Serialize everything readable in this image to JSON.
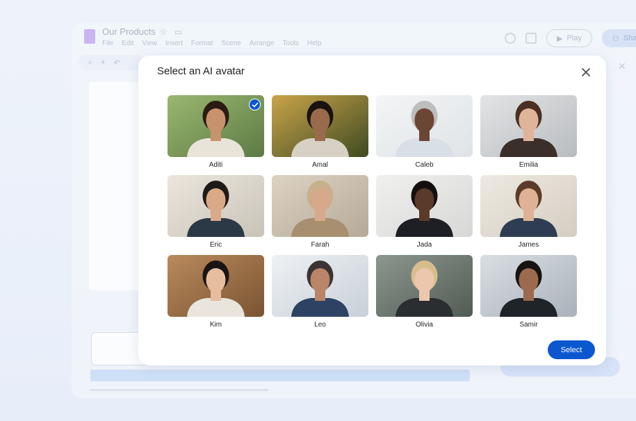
{
  "app": {
    "title": "Our Products",
    "menu": [
      "File",
      "Edit",
      "View",
      "Insert",
      "Format",
      "Scene",
      "Arrange",
      "Tools",
      "Help"
    ],
    "play_label": "Play",
    "share_label": "Share"
  },
  "dialog": {
    "title": "Select an AI avatar",
    "close_icon": "close-icon",
    "select_label": "Select",
    "selected_avatar": "Aditi",
    "avatars": [
      {
        "name": "Aditi",
        "bg": "#5d7a45",
        "bg2": "#9ab870",
        "skin": "#c8926e",
        "hair": "#2b1a12",
        "shirt": "#e9e4d8",
        "selected": true
      },
      {
        "name": "Amal",
        "bg": "#3f4a22",
        "bg2": "#c9a44a",
        "skin": "#9a6a4c",
        "hair": "#1a1210",
        "shirt": "#d7d0c4",
        "selected": false
      },
      {
        "name": "Caleb",
        "bg": "#dfe3e6",
        "bg2": "#f3f5f6",
        "skin": "#6b4634",
        "hair": "#bdbdbd",
        "shirt": "#d8dfe6",
        "selected": false
      },
      {
        "name": "Emilia",
        "bg": "#b9bcbf",
        "bg2": "#e2e4e5",
        "skin": "#e0b49a",
        "hair": "#4a2f22",
        "shirt": "#3a2f2a",
        "selected": false
      },
      {
        "name": "Eric",
        "bg": "#c9c3b8",
        "bg2": "#ebe6dd",
        "skin": "#d9a988",
        "hair": "#1e1a18",
        "shirt": "#2b3946",
        "selected": false
      },
      {
        "name": "Farah",
        "bg": "#b5aa98",
        "bg2": "#ddd3c3",
        "skin": "#d8a88a",
        "hair": "#c9b08c",
        "shirt": "#a78f6f",
        "selected": false
      },
      {
        "name": "Jada",
        "bg": "#d7d8d6",
        "bg2": "#f0f0ef",
        "skin": "#5a3a28",
        "hair": "#141010",
        "shirt": "#1d1f24",
        "selected": false
      },
      {
        "name": "James",
        "bg": "#d4cdc2",
        "bg2": "#eee9e1",
        "skin": "#e0b295",
        "hair": "#5b3c29",
        "shirt": "#2e3d52",
        "selected": false
      },
      {
        "name": "Kim",
        "bg": "#7a5432",
        "bg2": "#b98a5c",
        "skin": "#e6bd9e",
        "hair": "#1a1412",
        "shirt": "#e9e5dc",
        "selected": false
      },
      {
        "name": "Leo",
        "bg": "#c8d0d8",
        "bg2": "#eef1f4",
        "skin": "#b98467",
        "hair": "#3a3432",
        "shirt": "#2c4363",
        "selected": false
      },
      {
        "name": "Olivia",
        "bg": "#4f5b53",
        "bg2": "#8c988f",
        "skin": "#ecc7ae",
        "hair": "#d8bd8c",
        "shirt": "#2a2e30",
        "selected": false
      },
      {
        "name": "Samir",
        "bg": "#a9b2ba",
        "bg2": "#d9dee3",
        "skin": "#9c6a4e",
        "hair": "#161210",
        "shirt": "#1f2428",
        "selected": false
      }
    ]
  },
  "colors": {
    "accent": "#0b57d0",
    "text": "#1f1f1f",
    "dialog_bg": "#ffffff"
  }
}
